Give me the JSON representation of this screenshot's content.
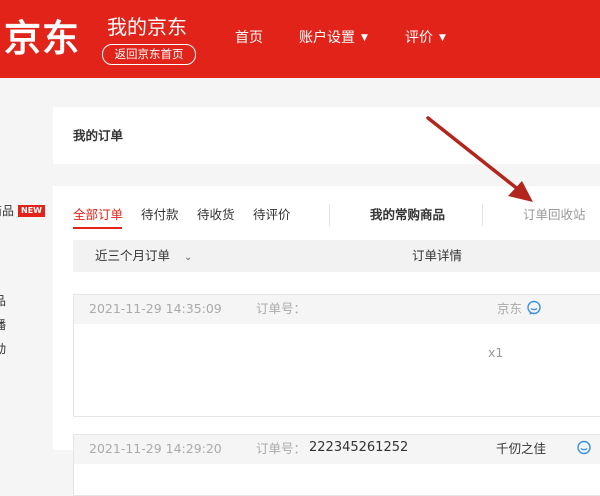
{
  "header": {
    "logo": "京东",
    "title": "我的京东",
    "back_home": "返回京东首页",
    "nav": [
      {
        "label": "首页"
      },
      {
        "label": "账户设置"
      },
      {
        "label": "评价"
      }
    ]
  },
  "sidebar": {
    "item_products": "商品",
    "new_badge": "NEW",
    "fragments": [
      "品",
      "播",
      "动"
    ]
  },
  "page_title": "我的订单",
  "tabs": [
    {
      "label": "全部订单",
      "active": true
    },
    {
      "label": "待付款"
    },
    {
      "label": "待收货"
    },
    {
      "label": "待评价"
    }
  ],
  "favorites": "我的常购商品",
  "recycle_bin": "订单回收站",
  "filter": {
    "selected": "近三个月订单",
    "detail_header": "订单详情"
  },
  "orders": [
    {
      "date": "2021-11-29 14:35:09",
      "number_label": "订单号：",
      "number": "",
      "shop": "京东",
      "qty": "x1"
    },
    {
      "date": "2021-11-29 14:29:20",
      "number_label": "订单号：",
      "number": "222345261252",
      "shop": "千仞之佳"
    }
  ],
  "colors": {
    "brand": "#e2231a",
    "annotation_arrow": "#b3261e",
    "chat_icon": "#3b8fe0"
  }
}
